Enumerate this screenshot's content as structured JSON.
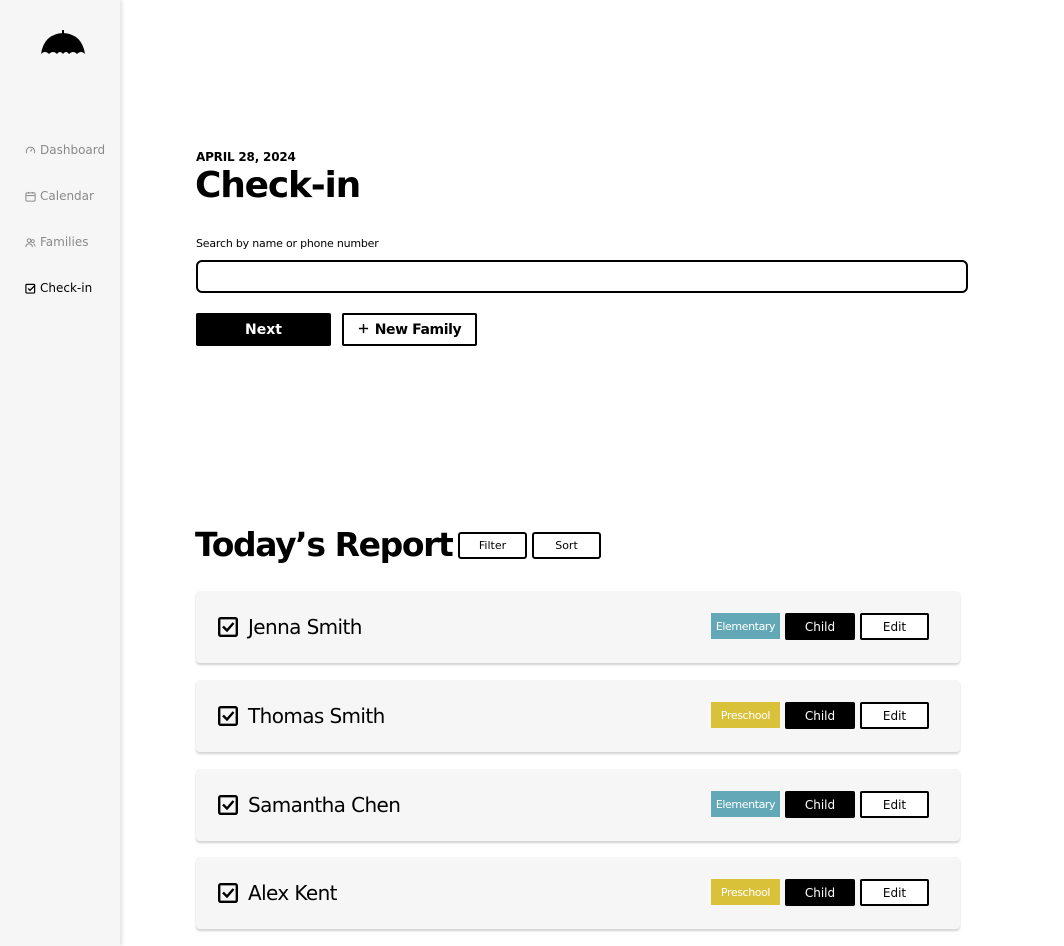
{
  "nav": {
    "items": [
      {
        "label": "Dashboard",
        "icon": "gauge-icon"
      },
      {
        "label": "Calendar",
        "icon": "calendar-icon"
      },
      {
        "label": "Families",
        "icon": "users-icon"
      },
      {
        "label": "Check-in",
        "icon": "checkbox-icon",
        "active": true
      }
    ]
  },
  "header": {
    "date": "APRIL 28, 2024",
    "title": "Check-in"
  },
  "search": {
    "label": "Search by name or phone number",
    "value": "",
    "placeholder": ""
  },
  "actions": {
    "next_label": "Next",
    "new_family_label": "New Family"
  },
  "report": {
    "title": "Today’s Report",
    "filter_label": "Filter",
    "sort_label": "Sort",
    "rows": [
      {
        "name": "Jenna Smith",
        "group": "Elementary",
        "type": "Child",
        "edit": "Edit"
      },
      {
        "name": "Thomas Smith",
        "group": "Preschool",
        "type": "Child",
        "edit": "Edit"
      },
      {
        "name": "Samantha Chen",
        "group": "Elementary",
        "type": "Child",
        "edit": "Edit"
      },
      {
        "name": "Alex Kent",
        "group": "Preschool",
        "type": "Child",
        "edit": "Edit"
      }
    ]
  },
  "colors": {
    "elementary": "#63a8b6",
    "preschool": "#d9c23a",
    "sidebar_bg": "#f6f6f6",
    "row_bg": "#f6f6f6"
  }
}
